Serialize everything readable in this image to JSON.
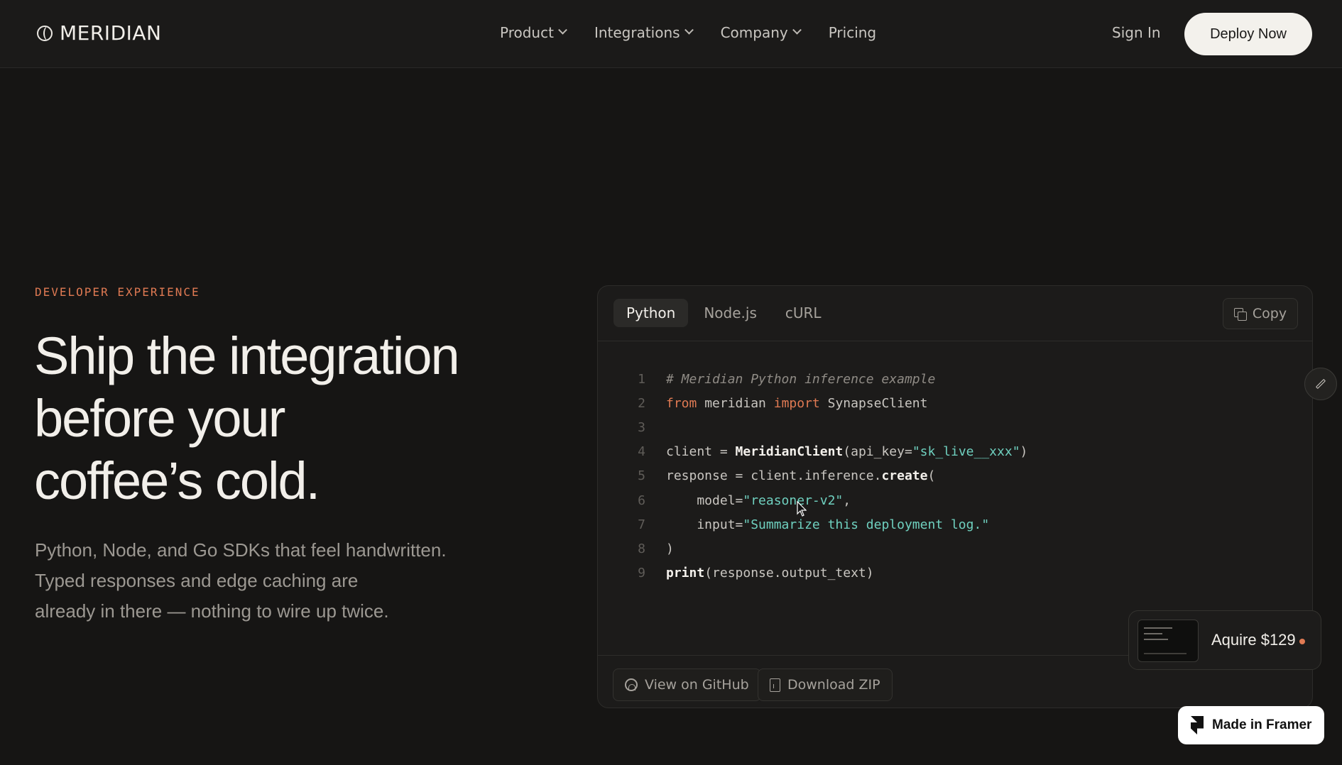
{
  "nav": {
    "brand": "MERIDIAN",
    "links": [
      {
        "label": "Product",
        "dropdown": true
      },
      {
        "label": "Integrations",
        "dropdown": true
      },
      {
        "label": "Company",
        "dropdown": true
      },
      {
        "label": "Pricing",
        "dropdown": false
      }
    ],
    "sign_in": "Sign In",
    "cta": "Deploy Now"
  },
  "hero": {
    "eyebrow": "DEVELOPER EXPERIENCE",
    "headline_lines": [
      "Ship the integration",
      "before your",
      "coffee’s cold."
    ],
    "subcopy_lines": [
      "Python, Node, and Go SDKs that feel handwritten.",
      "Typed responses and edge caching are",
      "already in there — nothing to wire up twice."
    ]
  },
  "code_panel": {
    "tabs": [
      "Python",
      "Node.js",
      "cURL"
    ],
    "active_tab": "Python",
    "copy_label": "Copy",
    "lines": [
      {
        "n": "1",
        "tokens": [
          {
            "t": "# Meridian Python inference example",
            "c": "com"
          }
        ]
      },
      {
        "n": "2",
        "tokens": [
          {
            "t": "from",
            "c": "kw"
          },
          {
            "t": " meridian ",
            "c": "pl"
          },
          {
            "t": "import",
            "c": "kw"
          },
          {
            "t": " SynapseClient",
            "c": "pl"
          }
        ]
      },
      {
        "n": "3",
        "tokens": []
      },
      {
        "n": "4",
        "tokens": [
          {
            "t": "client = ",
            "c": "pl"
          },
          {
            "t": "MeridianClient",
            "c": "fn"
          },
          {
            "t": "(api_key=",
            "c": "pl"
          },
          {
            "t": "\"sk_live__xxx\"",
            "c": "str"
          },
          {
            "t": ")",
            "c": "pl"
          }
        ]
      },
      {
        "n": "5",
        "tokens": [
          {
            "t": "response = client.inference.",
            "c": "pl"
          },
          {
            "t": "create",
            "c": "fn"
          },
          {
            "t": "(",
            "c": "pl"
          }
        ]
      },
      {
        "n": "6",
        "tokens": [
          {
            "t": "    model=",
            "c": "pl"
          },
          {
            "t": "\"reasoner-v2\"",
            "c": "str"
          },
          {
            "t": ",",
            "c": "pl"
          }
        ]
      },
      {
        "n": "7",
        "tokens": [
          {
            "t": "    input=",
            "c": "pl"
          },
          {
            "t": "\"Summarize this deployment log.\"",
            "c": "str"
          }
        ]
      },
      {
        "n": "8",
        "tokens": [
          {
            "t": ")",
            "c": "pl"
          }
        ]
      },
      {
        "n": "9",
        "tokens": [
          {
            "t": "print",
            "c": "fn"
          },
          {
            "t": "(response.output_text)",
            "c": "pl"
          }
        ]
      }
    ],
    "footer_buttons": [
      "View on GitHub",
      "Download ZIP"
    ]
  },
  "acquire": {
    "label": "Aquire $129"
  },
  "badge": {
    "label": "Made in Framer"
  },
  "icons": {
    "logo": "meridian-logo-icon",
    "copy": "copy-icon",
    "github": "github-icon",
    "download": "file-icon",
    "edit": "pencil-icon",
    "framer": "framer-icon",
    "cursor": "mouse-cursor-icon"
  },
  "colors": {
    "accent": "#e07a53",
    "string": "#6fd0bf",
    "background": "#161514"
  }
}
